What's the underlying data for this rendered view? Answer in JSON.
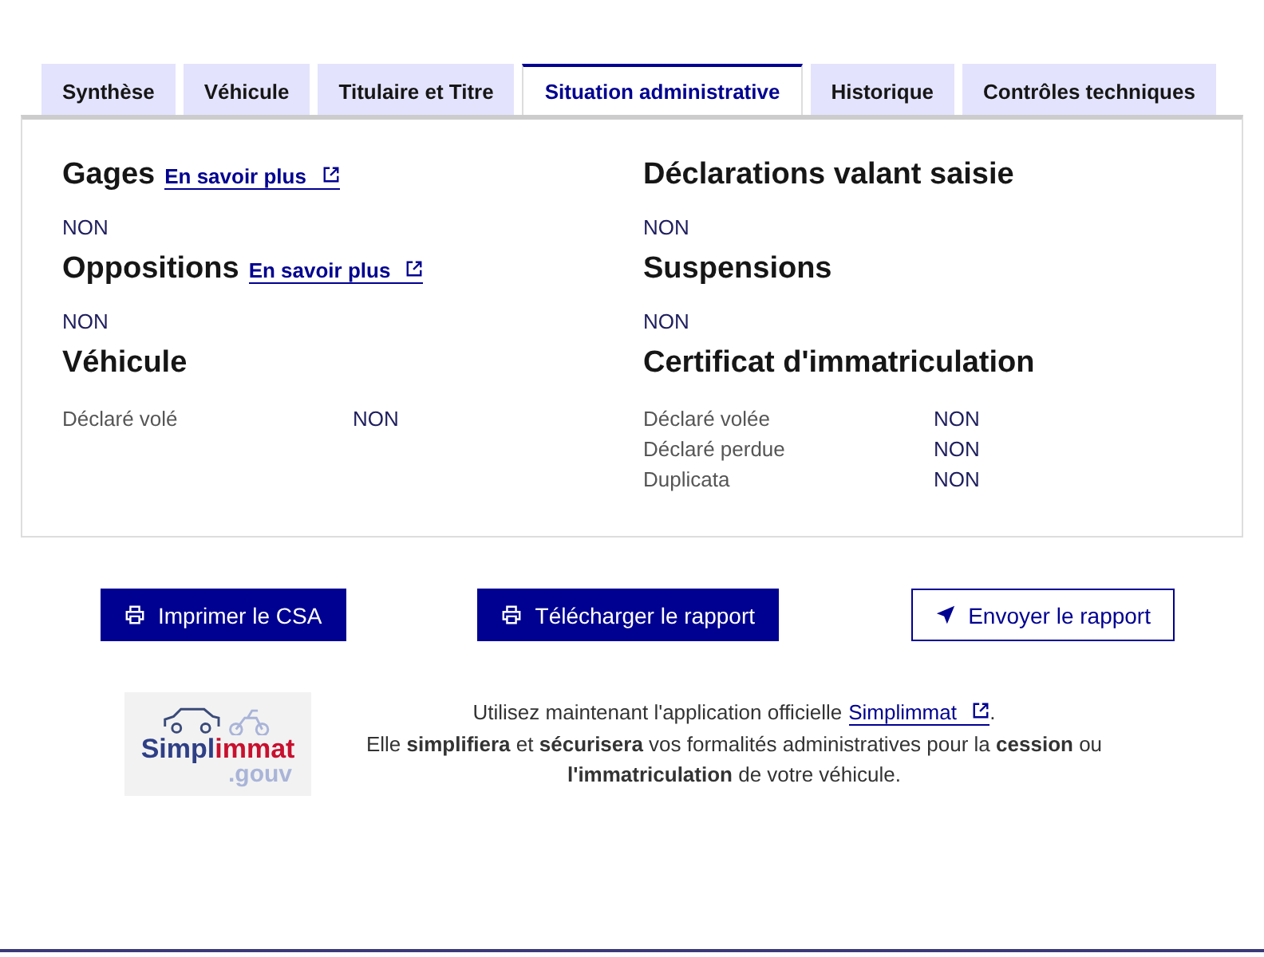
{
  "tabs": [
    {
      "label": "Synthèse",
      "selected": false
    },
    {
      "label": "Véhicule",
      "selected": false
    },
    {
      "label": "Titulaire et Titre",
      "selected": false
    },
    {
      "label": "Situation administrative",
      "selected": true
    },
    {
      "label": "Historique",
      "selected": false
    },
    {
      "label": "Contrôles techniques",
      "selected": false
    }
  ],
  "sections": [
    {
      "kind": "value",
      "title": "Gages",
      "link": "En savoir plus",
      "value": "NON"
    },
    {
      "kind": "value",
      "title": "Déclarations valant saisie",
      "value": "NON"
    },
    {
      "kind": "value",
      "title": "Oppositions",
      "link": "En savoir plus",
      "value": "NON"
    },
    {
      "kind": "value",
      "title": "Suspensions",
      "value": "NON"
    },
    {
      "kind": "rows",
      "title": "Véhicule",
      "rows": [
        {
          "label": "Déclaré volé",
          "value": "NON"
        }
      ]
    },
    {
      "kind": "rows",
      "title": "Certificat d'immatriculation",
      "rows": [
        {
          "label": "Déclaré volée",
          "value": "NON"
        },
        {
          "label": "Déclaré perdue",
          "value": "NON"
        },
        {
          "label": "Duplicata",
          "value": "NON"
        }
      ]
    }
  ],
  "buttons": [
    {
      "label": "Imprimer le CSA",
      "kind": "print"
    },
    {
      "label": "Télécharger le rapport",
      "kind": "print"
    },
    {
      "label": "Envoyer le rapport",
      "kind": "send"
    }
  ],
  "footer": {
    "logo": {
      "name_start": "Simpl",
      "name_end": "immat",
      "suffix": ".gouv"
    },
    "text_before": "Utilisez maintenant l'application officielle",
    "link": "Simplimmat",
    "text_after": ".",
    "text_second": "Elle **simplifiera** et **sécurisera** vos formalités administratives pour la **cession** ou **l'immatriculation** de votre véhicule."
  }
}
